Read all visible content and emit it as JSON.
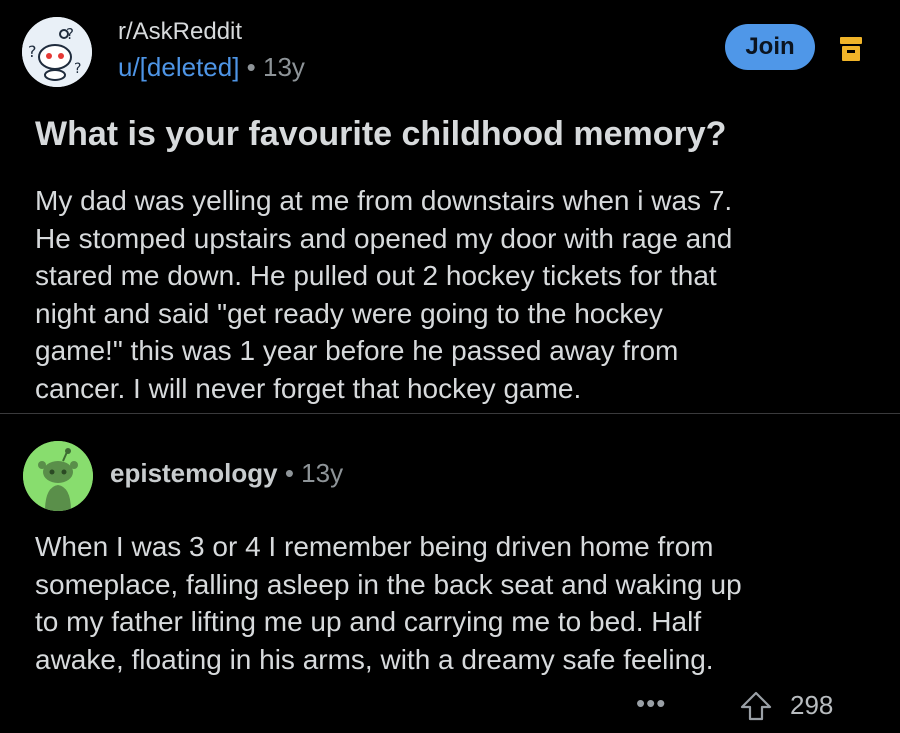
{
  "post": {
    "subreddit": "r/AskReddit",
    "author": "u/[deleted]",
    "separator": "•",
    "age": "13y",
    "join_label": "Join",
    "title": "What is your favourite childhood memory?",
    "body_lines": [
      "My dad was yelling at me from downstairs when i was 7.",
      "He stomped upstairs and opened my door with rage and",
      "stared me down. He pulled out 2 hockey tickets for that",
      "night and said \"get ready were going to the hockey",
      "game!\" this was 1 year before he passed away from",
      "cancer. I will never forget that hockey game."
    ]
  },
  "comment": {
    "author": "epistemology",
    "separator": "•",
    "age": "13y",
    "body_lines": [
      "When I was 3 or 4 I remember being driven home from",
      "someplace, falling asleep in the back seat and waking up",
      "to my father lifting me up and carrying me to bed. Half",
      "awake, floating in his arms, with a dreamy safe feeling."
    ],
    "more_label": "•••",
    "vote_count": "298"
  },
  "icons": {
    "subreddit_avatar": "askreddit-snoo-icon",
    "archive": "archive-icon",
    "comment_avatar": "snoo-avatar-icon",
    "more": "more-options-icon",
    "upvote": "upvote-arrow-icon"
  },
  "colors": {
    "background": "#000000",
    "text": "#d7dadc",
    "muted": "#8e9498",
    "author_link": "#4e95e6",
    "join_button": "#4f97e8",
    "archive_icon": "#f0b429",
    "comment_avatar_bg": "#88dd6e"
  }
}
